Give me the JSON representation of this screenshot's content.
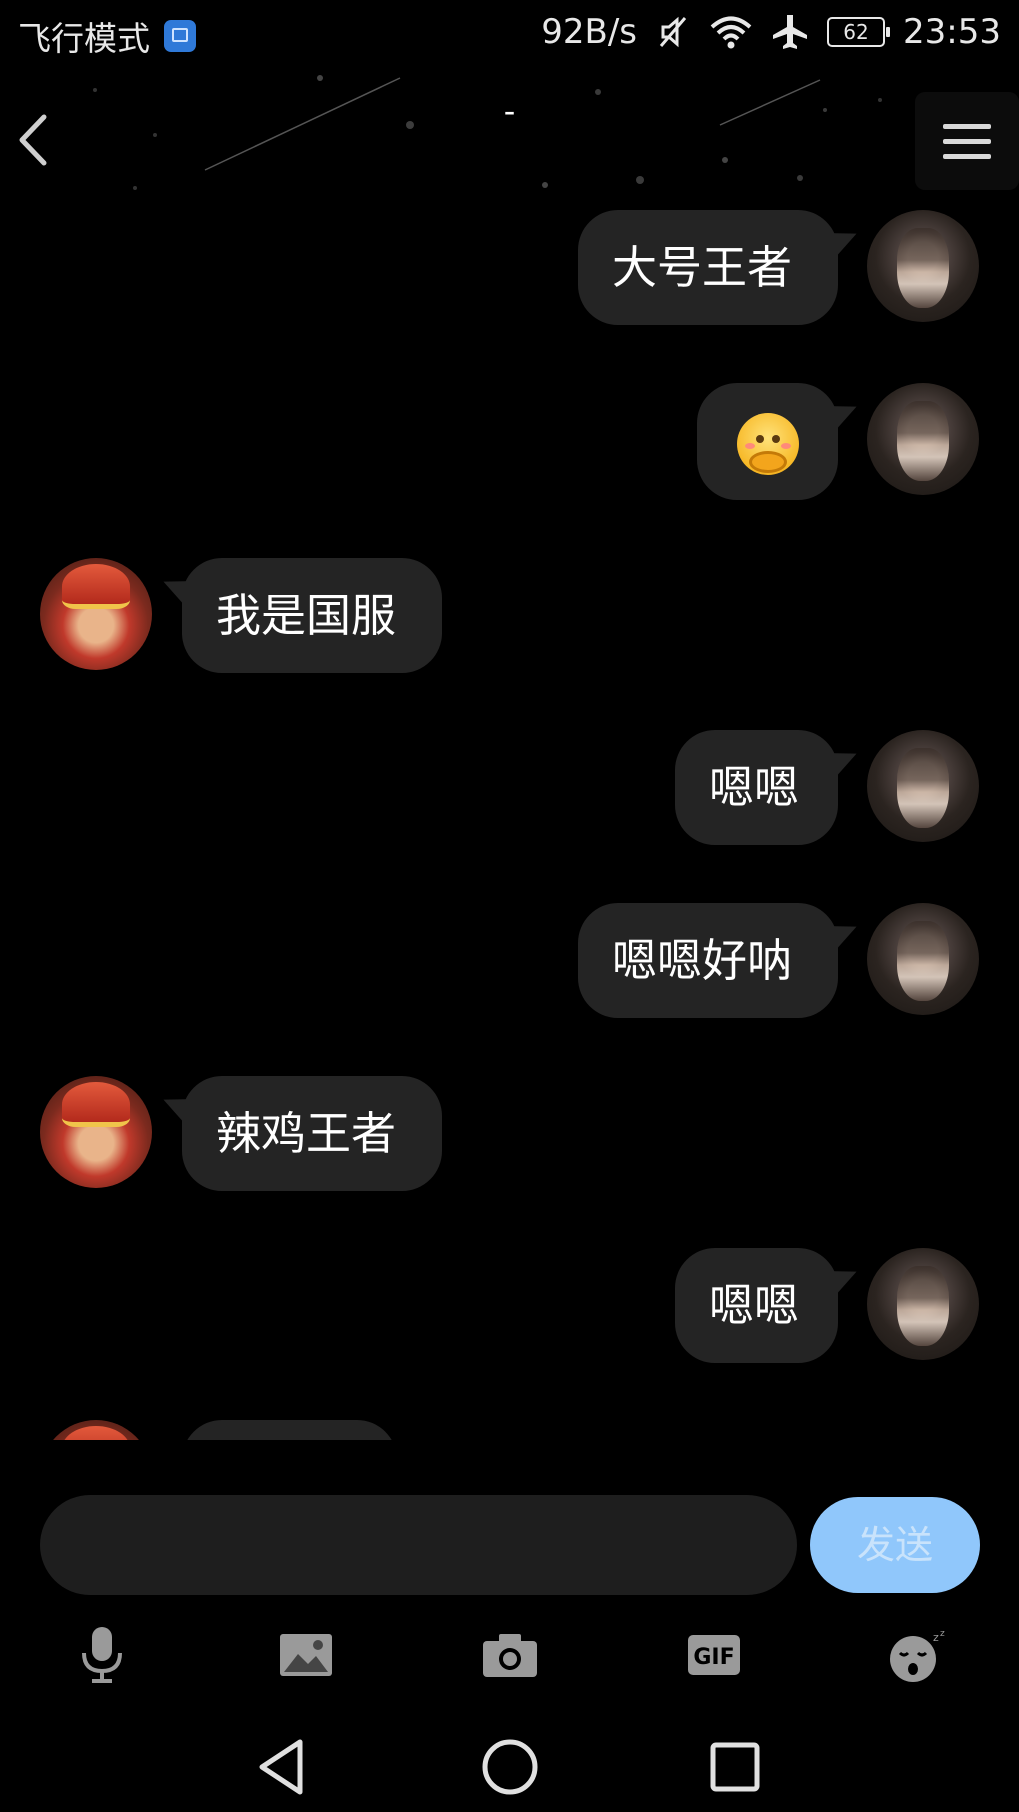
{
  "status_bar": {
    "mode_label": "飞行模式",
    "net_speed": "92B/s",
    "battery_level": "62",
    "time": "23:53"
  },
  "header": {
    "title": "-"
  },
  "messages": [
    {
      "side": "me",
      "text": "大号王者"
    },
    {
      "side": "me",
      "emoji": "hugging-face-emoji"
    },
    {
      "side": "them",
      "text": "我是国服"
    },
    {
      "side": "me",
      "text": "嗯嗯"
    },
    {
      "side": "me",
      "text": "嗯嗯好呐"
    },
    {
      "side": "them",
      "text": "辣鸡王者"
    },
    {
      "side": "me",
      "text": "嗯嗯"
    }
  ],
  "composer": {
    "input_value": "",
    "send_label": "发送"
  },
  "toolbar": {
    "items": [
      "microphone-icon",
      "image-icon",
      "camera-icon",
      "gif-icon",
      "sleepy-emoji-icon"
    ],
    "gif_label": "GIF"
  },
  "colors": {
    "background": "#000000",
    "bubble": "#242424",
    "send_button": "#90c7fb",
    "send_text": "#c9e3fb"
  }
}
